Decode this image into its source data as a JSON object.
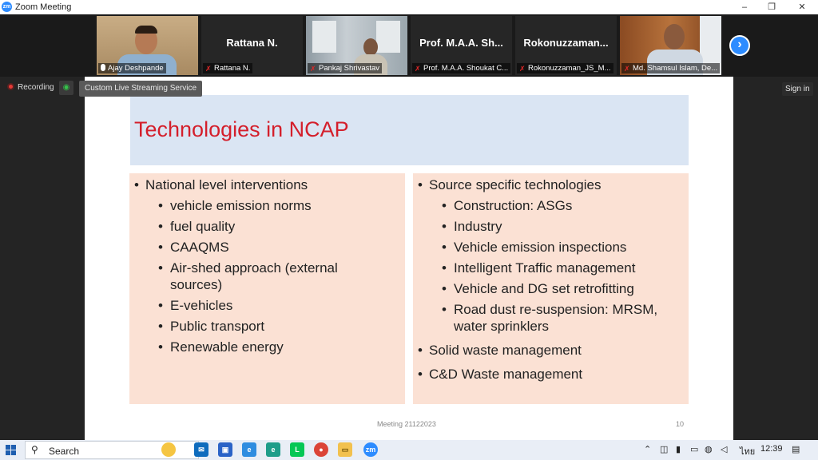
{
  "window": {
    "title": "Zoom Meeting",
    "controls": [
      "–",
      "❐",
      "✕"
    ]
  },
  "participants": [
    {
      "name": "Ajay Deshpande",
      "display": "",
      "video": true,
      "muted": false,
      "active": true
    },
    {
      "name": "Rattana N.",
      "display": "Rattana N.",
      "video": false,
      "muted": true,
      "active": false
    },
    {
      "name": "Pankaj Shrivastav",
      "display": "",
      "video": true,
      "muted": true,
      "active": false
    },
    {
      "name": "Prof. M.A.A. Shoukat C...",
      "display": "Prof. M.A.A. Sh...",
      "video": false,
      "muted": true,
      "active": false
    },
    {
      "name": "Rokonuzzaman_JS_M...",
      "display": "Rokonuzzaman...",
      "video": false,
      "muted": true,
      "active": false
    },
    {
      "name": "Md. Shamsul Islam, De...",
      "display": "",
      "video": true,
      "muted": true,
      "active": false
    }
  ],
  "next_page_icon": "chevron-right-icon",
  "status": {
    "recording_label": "Recording",
    "live_stream_label": "Custom Live Streaming Service",
    "sign_in_label": "Sign in"
  },
  "slide": {
    "title": "Technologies in NCAP",
    "left_column": [
      {
        "level": 1,
        "text": "National level interventions"
      },
      {
        "level": 2,
        "text": "vehicle emission norms"
      },
      {
        "level": 2,
        "text": "fuel quality"
      },
      {
        "level": 2,
        "text": "CAAQMS"
      },
      {
        "level": 2,
        "text": "Air-shed approach (external sources)"
      },
      {
        "level": 2,
        "text": "E-vehicles"
      },
      {
        "level": 2,
        "text": "Public transport"
      },
      {
        "level": 2,
        "text": "Renewable energy"
      }
    ],
    "right_column": [
      {
        "level": 1,
        "text": "Source specific technologies"
      },
      {
        "level": 2,
        "text": "Construction: ASGs"
      },
      {
        "level": 2,
        "text": "Industry"
      },
      {
        "level": 2,
        "text": "Vehicle emission inspections"
      },
      {
        "level": 2,
        "text": "Intelligent Traffic management"
      },
      {
        "level": 2,
        "text": "Vehicle and DG set retrofitting"
      },
      {
        "level": 2,
        "text": "Road dust re-suspension: MRSM, water sprinklers"
      },
      {
        "level": 1,
        "text": "Solid waste management"
      },
      {
        "level": 1,
        "text": "C&D Waste management"
      }
    ],
    "footer": "Meeting 21122023",
    "page_number": "10",
    "colors": {
      "title": "#d41f2b",
      "title_band": "#dae5f3",
      "column_bg": "#fbe1d4"
    }
  },
  "taskbar": {
    "search_label": "Search",
    "apps": [
      "widgets",
      "mail",
      "store",
      "ie",
      "edge",
      "line",
      "chrome",
      "explorer",
      "zoom"
    ],
    "language": "ไทย",
    "time": "12:39"
  }
}
